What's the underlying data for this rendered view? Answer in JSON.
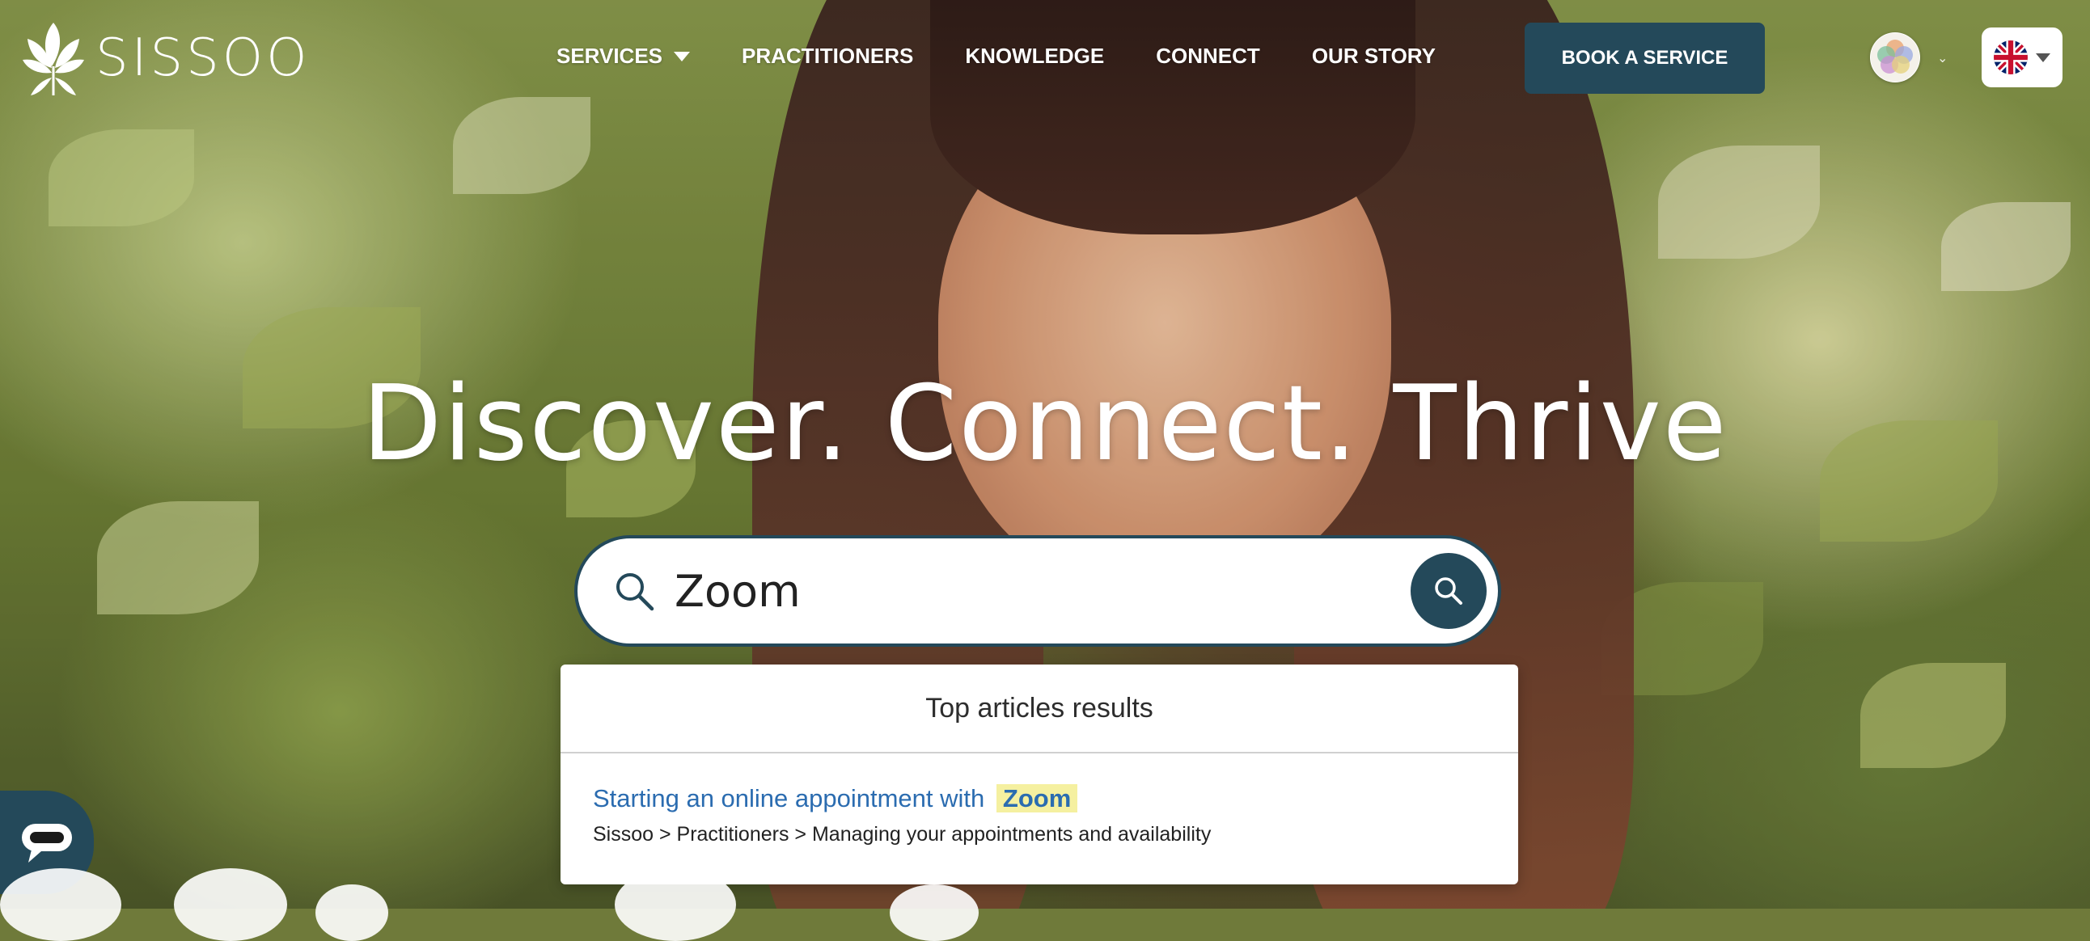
{
  "brand": {
    "name": "SISSOO"
  },
  "nav": {
    "items": [
      {
        "label": "SERVICES",
        "has_dropdown": true
      },
      {
        "label": "PRACTITIONERS"
      },
      {
        "label": "KNOWLEDGE"
      },
      {
        "label": "CONNECT"
      },
      {
        "label": "OUR STORY"
      }
    ],
    "cta_label": "BOOK A SERVICE"
  },
  "hero": {
    "title": "Discover. Connect. Thrive"
  },
  "search": {
    "value": "Zoom",
    "placeholder": ""
  },
  "results": {
    "header": "Top articles results",
    "items": [
      {
        "title_prefix": "Starting an online appointment with",
        "title_match": "Zoom",
        "path": "Sissoo > Practitioners > Managing your appointments and availability"
      }
    ]
  },
  "colors": {
    "accent": "#24495a",
    "link": "#2b6cb0",
    "highlight": "#f5f0a0"
  },
  "icons": {
    "logo": "leaf-logo-icon",
    "search": "search-icon",
    "chat": "chat-icon",
    "language": "uk-flag-icon"
  }
}
